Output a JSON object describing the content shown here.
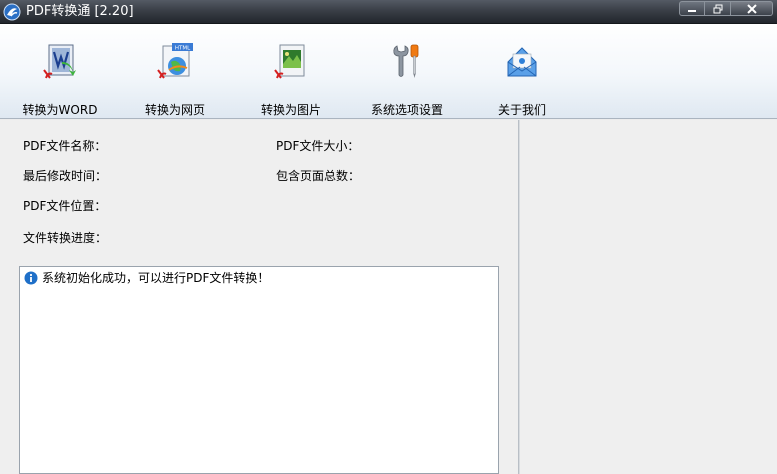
{
  "window": {
    "title": "PDF转换通 [2.20]",
    "controls": [
      "minimize-icon",
      "restore-icon",
      "close-icon"
    ]
  },
  "toolbar": {
    "items": [
      {
        "label": "转换为WORD",
        "icon": "pdf-to-word-icon"
      },
      {
        "label": "转换为网页",
        "icon": "pdf-to-html-icon"
      },
      {
        "label": "转换为图片",
        "icon": "pdf-to-image-icon"
      },
      {
        "label": "系统选项设置",
        "icon": "settings-tools-icon"
      },
      {
        "label": "关于我们",
        "icon": "about-mail-icon"
      }
    ]
  },
  "info": {
    "file_name_label": "PDF文件名称：",
    "file_size_label": "PDF文件大小：",
    "modified_label": "最后修改时间：",
    "page_count_label": "包含页面总数：",
    "location_label": "PDF文件位置：",
    "progress_label": "文件转换进度："
  },
  "log": {
    "messages": [
      {
        "icon": "info-icon",
        "text": "系统初始化成功，可以进行PDF文件转换！"
      }
    ]
  },
  "colors": {
    "titlebar": "#2e333a",
    "toolbar": "#f3f7fb",
    "panel": "#efefef",
    "accent": "#1e6fc8"
  }
}
